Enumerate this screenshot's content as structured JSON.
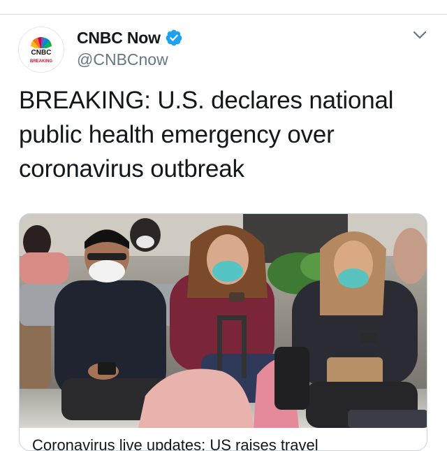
{
  "author": {
    "display_name": "CNBC Now",
    "handle": "@CNBCnow",
    "verified": true,
    "avatar_icon": "cnbc-peacock-logo",
    "avatar_text": "CNBC",
    "avatar_subtext": "BREAKING"
  },
  "tweet": {
    "text_lines": [
      "BREAKING: U.S. declares national",
      "public health emergency over",
      "coronavirus outbreak"
    ]
  },
  "card": {
    "image_icon": "travelers-wearing-masks-photo",
    "title_partial": "Coronavirus live updates: US raises travel"
  },
  "colors": {
    "verified_blue": "#1da1f2",
    "handle_gray": "#657786",
    "divider": "#d7dbdf",
    "cnbc_red": "#c8102e"
  },
  "icons": {
    "verified": "verified-badge-icon",
    "menu": "chevron-down-icon"
  }
}
